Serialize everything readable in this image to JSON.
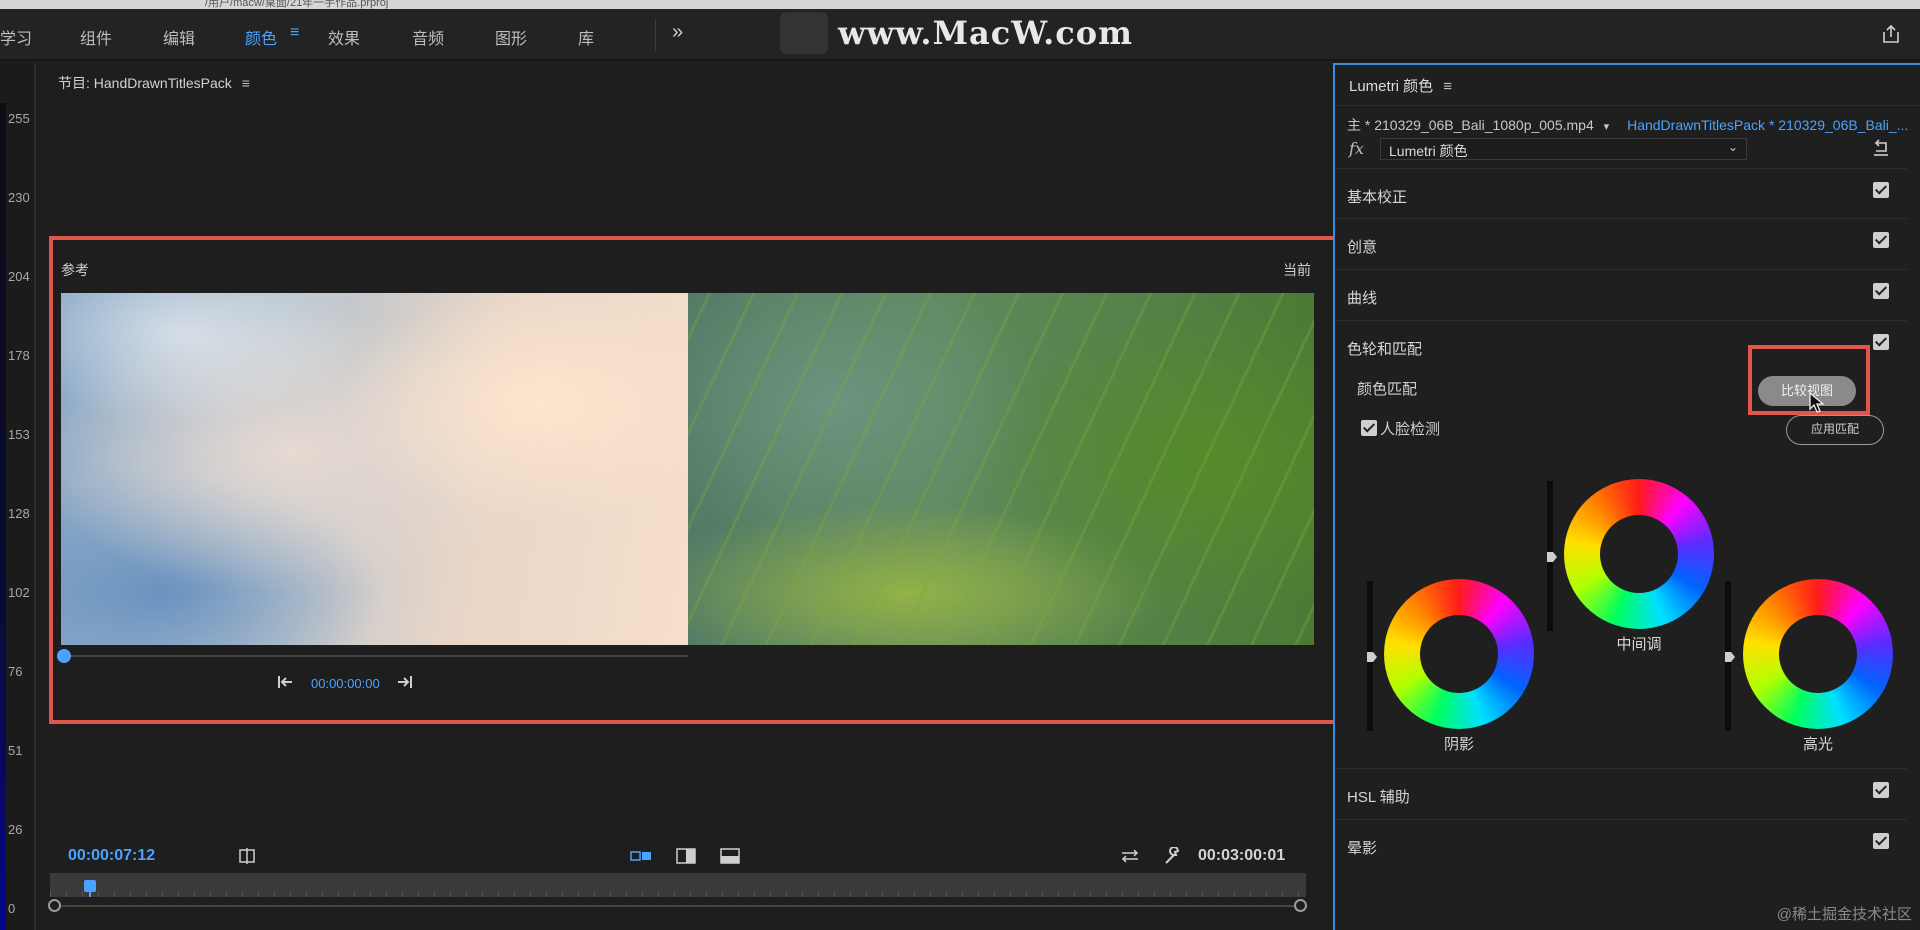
{
  "path_fragment": "/用户/macw/桌面/21年一手作品.prproj",
  "workspaces": {
    "tabs": [
      {
        "label": "学习"
      },
      {
        "label": "组件"
      },
      {
        "label": "编辑"
      },
      {
        "label": "颜色"
      },
      {
        "label": "效果"
      },
      {
        "label": "音频"
      },
      {
        "label": "图形"
      },
      {
        "label": "库"
      }
    ],
    "active": "颜色",
    "menu_glyph": "≡",
    "more_glyph": "»"
  },
  "watermark": {
    "text": "www.MacW.com"
  },
  "scale": {
    "ticks": [
      "255",
      "230",
      "204",
      "178",
      "153",
      "128",
      "102",
      "76",
      "51",
      "26",
      "0"
    ]
  },
  "program": {
    "title": "节目: HandDrawnTitlesPack",
    "menu_glyph": "≡",
    "reference_label": "参考",
    "current_label": "当前",
    "reference_timecode": "00:00:00:00",
    "timecode_current": "00:00:07:12",
    "timecode_duration": "00:03:00:01"
  },
  "lumetri": {
    "title": "Lumetri 颜色",
    "menu_glyph": "≡",
    "master_clip": "主 * 210329_06B_Bali_1080p_005.mp4",
    "sequence_clip": "HandDrawnTitlesPack * 210329_06B_Bali_...",
    "fx_label": "fx",
    "effect_select": "Lumetri 颜色",
    "sections": [
      {
        "label": "基本校正",
        "checked": true
      },
      {
        "label": "创意",
        "checked": true
      },
      {
        "label": "曲线",
        "checked": true
      },
      {
        "label": "色轮和匹配",
        "checked": true
      },
      {
        "label": "HSL 辅助",
        "checked": true
      },
      {
        "label": "晕影",
        "checked": true
      }
    ],
    "color_match_label": "颜色匹配",
    "compare_view_button": "比较视图",
    "face_detection_label": "人脸检测",
    "face_detection_checked": true,
    "apply_match_button": "应用匹配",
    "wheels": {
      "shadows": "阴影",
      "midtones": "中间调",
      "highlights": "高光"
    }
  },
  "credit": "@稀土掘金技术社区",
  "colors": {
    "accent": "#4aa3ff",
    "highlight_frame": "#e0564a",
    "panel_bg": "#1f1f1f"
  }
}
